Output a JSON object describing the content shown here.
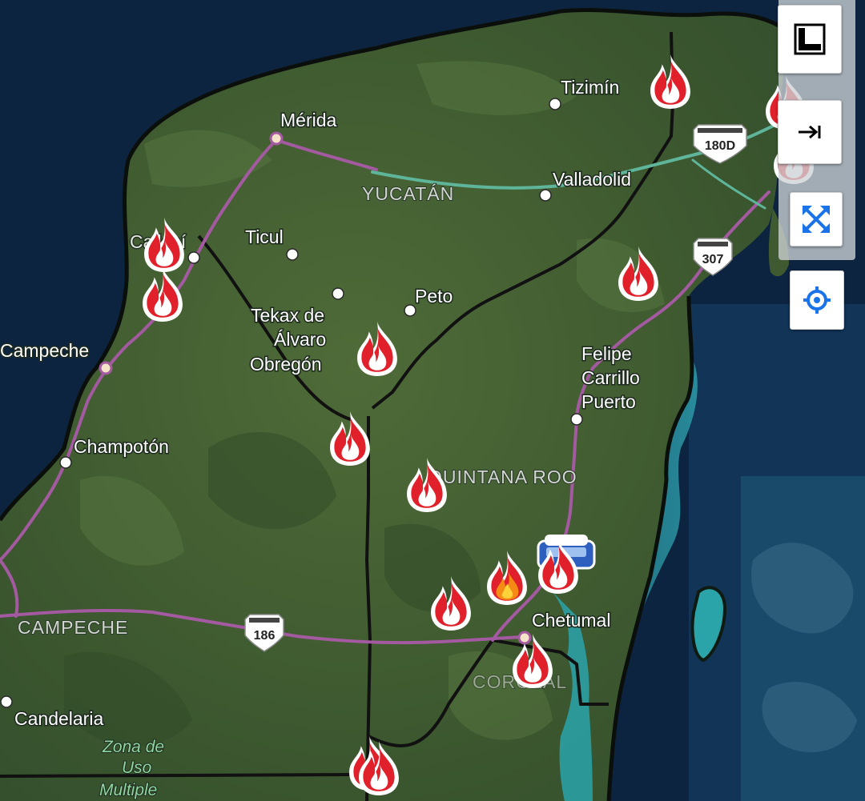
{
  "map": {
    "cities": [
      {
        "name": "Mérida"
      },
      {
        "name": "Tizimín"
      },
      {
        "name": "Valladolid"
      },
      {
        "name": "Ticul"
      },
      {
        "name": "Peto"
      },
      {
        "name": "Tekax de"
      },
      {
        "name": "Álvaro"
      },
      {
        "name": "Obregón"
      },
      {
        "name": "Felipe"
      },
      {
        "name": "Carrillo"
      },
      {
        "name": "Puerto"
      },
      {
        "name": "Campeche"
      },
      {
        "name": "Champotón"
      },
      {
        "name": "Chetumal"
      },
      {
        "name": "Candelaria"
      },
      {
        "name": "Calkiní"
      }
    ],
    "states": [
      "YUCATÁN",
      "QUINTANA ROO",
      "CAMPECHE",
      "COROZAL"
    ],
    "zone_label": [
      "Zona de",
      "Uso",
      "Multiple"
    ],
    "highway_shields": [
      "180D",
      "307",
      "186"
    ],
    "fire_icon": "fire-hotspot-icon",
    "active_fire_icon": "active-fire-icon",
    "colors": {
      "fire": "#e0202a",
      "fire_active": "#f58a14",
      "highway": "#a35aa0",
      "toll_road": "#5fb59a",
      "border": "#111111",
      "control_blue": "#1a73e8"
    }
  },
  "controls": [
    {
      "name": "basemap-toggle",
      "icon": "map-frame-icon"
    },
    {
      "name": "expand-panel",
      "icon": "arrow-right-bar-icon"
    },
    {
      "name": "fullscreen",
      "icon": "expand-arrows-icon"
    },
    {
      "name": "my-location",
      "icon": "crosshair-icon"
    }
  ]
}
